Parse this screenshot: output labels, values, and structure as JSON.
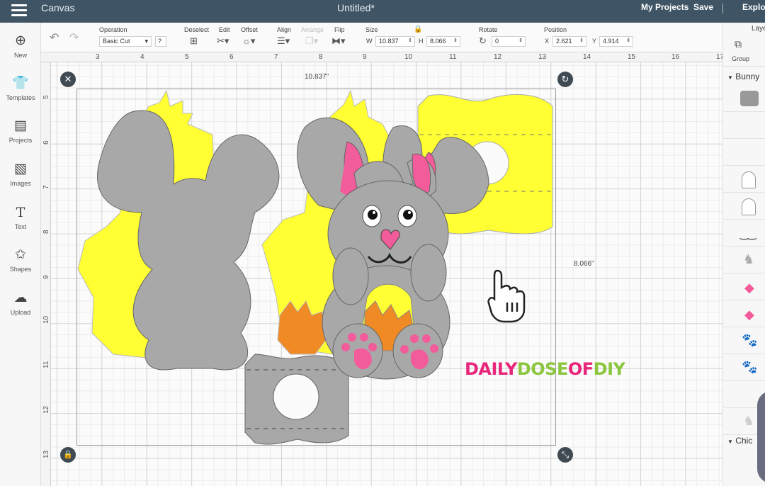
{
  "topbar": {
    "app_name": "Canvas",
    "document_title": "Untitled*",
    "my_projects": "My Projects",
    "save": "Save",
    "explore": "Explore"
  },
  "toolbar": {
    "operation_label": "Operation",
    "operation_value": "Basic Cut",
    "operation_help": "?",
    "deselect_label": "Deselect",
    "edit_label": "Edit",
    "offset_label": "Offset",
    "align_label": "Align",
    "arrange_label": "Arrange",
    "flip_label": "Flip",
    "size_label": "Size",
    "width_prefix": "W",
    "width_value": "10.837",
    "height_prefix": "H",
    "height_value": "8.066",
    "rotate_label": "Rotate",
    "rotate_value": "0",
    "position_label": "Position",
    "x_prefix": "X",
    "x_value": "2.621",
    "y_prefix": "Y",
    "y_value": "4.914"
  },
  "sidebar": {
    "items": [
      {
        "label": "New"
      },
      {
        "label": "Templates"
      },
      {
        "label": "Projects"
      },
      {
        "label": "Images"
      },
      {
        "label": "Text"
      },
      {
        "label": "Shapes"
      },
      {
        "label": "Upload"
      }
    ]
  },
  "layers": {
    "header": "Layers",
    "group_label": "Group",
    "bunny_group": "Bunny",
    "chick_group": "Chic"
  },
  "ruler_top": [
    "3",
    "4",
    "5",
    "6",
    "7",
    "8",
    "9",
    "10",
    "11",
    "12",
    "13",
    "14",
    "15",
    "16",
    "17"
  ],
  "ruler_left": [
    "5",
    "6",
    "7",
    "8",
    "9",
    "10",
    "11",
    "12",
    "13"
  ],
  "canvas": {
    "width_dim": "10.837\"",
    "height_dim": "8.066\""
  },
  "watermark": {
    "part1": "DAILY",
    "part2": "DOSE",
    "part3": "OF",
    "part4": "DIY"
  },
  "colors": {
    "yellow": "#ffff33",
    "gray": "#a8a8a8",
    "pink": "#f25c9a",
    "orange": "#ef8a25",
    "topbar": "#3f5565"
  }
}
